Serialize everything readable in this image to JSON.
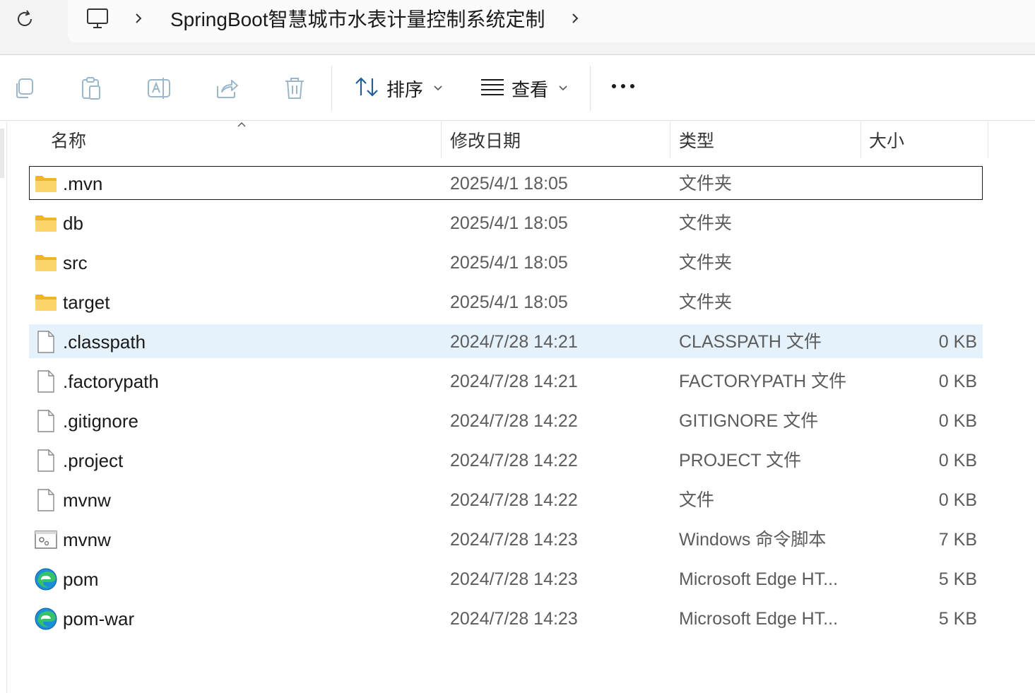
{
  "address_bar": {
    "path_segments": [
      "SpringBoot智慧城市水表计量控制系统定制"
    ],
    "icons": [
      "refresh-icon",
      "this-pc-icon",
      "chevron-right-icon"
    ]
  },
  "toolbar": {
    "sort_label": "排序",
    "view_label": "查看",
    "icons": [
      "copy-icon",
      "paste-icon",
      "rename-icon",
      "share-icon",
      "delete-icon",
      "sort-icon",
      "view-icon",
      "more-icon"
    ]
  },
  "columns": {
    "name": "名称",
    "date": "修改日期",
    "type": "类型",
    "size": "大小"
  },
  "files": [
    {
      "name": ".mvn",
      "date": "2025/4/1 18:05",
      "type": "文件夹",
      "size": "",
      "icon": "folder-icon",
      "state": "focused"
    },
    {
      "name": "db",
      "date": "2025/4/1 18:05",
      "type": "文件夹",
      "size": "",
      "icon": "folder-icon",
      "state": ""
    },
    {
      "name": "src",
      "date": "2025/4/1 18:05",
      "type": "文件夹",
      "size": "",
      "icon": "folder-icon",
      "state": ""
    },
    {
      "name": "target",
      "date": "2025/4/1 18:05",
      "type": "文件夹",
      "size": "",
      "icon": "folder-icon",
      "state": ""
    },
    {
      "name": ".classpath",
      "date": "2024/7/28 14:21",
      "type": "CLASSPATH 文件",
      "size": "0 KB",
      "icon": "file-icon",
      "state": "hover"
    },
    {
      "name": ".factorypath",
      "date": "2024/7/28 14:21",
      "type": "FACTORYPATH 文件",
      "size": "0 KB",
      "icon": "file-icon",
      "state": ""
    },
    {
      "name": ".gitignore",
      "date": "2024/7/28 14:22",
      "type": "GITIGNORE 文件",
      "size": "0 KB",
      "icon": "file-icon",
      "state": ""
    },
    {
      "name": ".project",
      "date": "2024/7/28 14:22",
      "type": "PROJECT 文件",
      "size": "0 KB",
      "icon": "file-icon",
      "state": ""
    },
    {
      "name": "mvnw",
      "date": "2024/7/28 14:22",
      "type": "文件",
      "size": "0 KB",
      "icon": "file-icon",
      "state": ""
    },
    {
      "name": "mvnw",
      "date": "2024/7/28 14:23",
      "type": "Windows 命令脚本",
      "size": "7 KB",
      "icon": "script-icon",
      "state": ""
    },
    {
      "name": "pom",
      "date": "2024/7/28 14:23",
      "type": "Microsoft Edge HT...",
      "size": "5 KB",
      "icon": "edge-icon",
      "state": ""
    },
    {
      "name": "pom-war",
      "date": "2024/7/28 14:23",
      "type": "Microsoft Edge HT...",
      "size": "5 KB",
      "icon": "edge-icon",
      "state": ""
    }
  ],
  "colors": {
    "hover_row": "#e5f1fb",
    "folder": "#f7c948",
    "address_bg": "#f3f3f3"
  }
}
